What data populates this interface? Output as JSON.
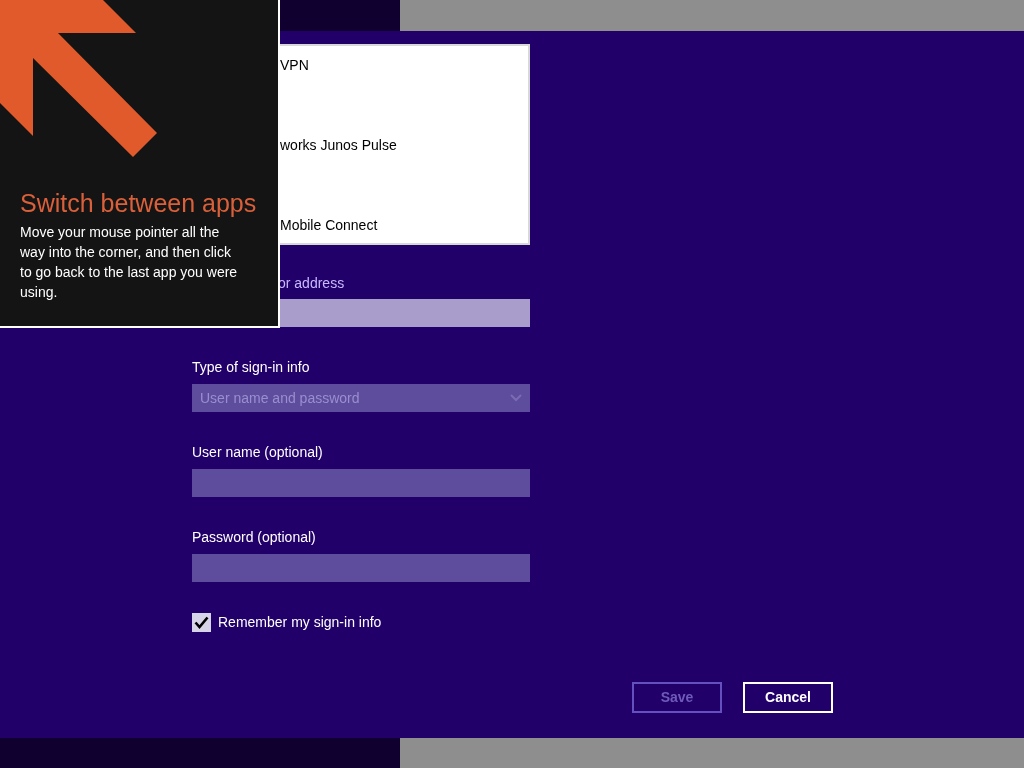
{
  "tip": {
    "title": "Switch between apps",
    "body": "Move your mouse pointer all the way into the corner, and then click to go back to the last app you were using."
  },
  "vpn_list": {
    "items": [
      {
        "label": "VPN"
      },
      {
        "label": "works Junos Pulse"
      },
      {
        "label": "Mobile Connect"
      }
    ]
  },
  "fields": [
    {
      "kind": "text",
      "label": "or address",
      "disabled": false
    },
    {
      "kind": "select",
      "label": "Type of sign-in info",
      "value": "User name and password",
      "disabled": true
    },
    {
      "kind": "text",
      "label": "User name (optional)",
      "disabled": true
    },
    {
      "kind": "text",
      "label": "Password (optional)",
      "disabled": true
    }
  ],
  "remember": {
    "label": "Remember my sign-in info",
    "checked": true
  },
  "buttons": [
    {
      "label": "Save",
      "disabled": true
    },
    {
      "label": "Cancel",
      "disabled": false
    }
  ]
}
